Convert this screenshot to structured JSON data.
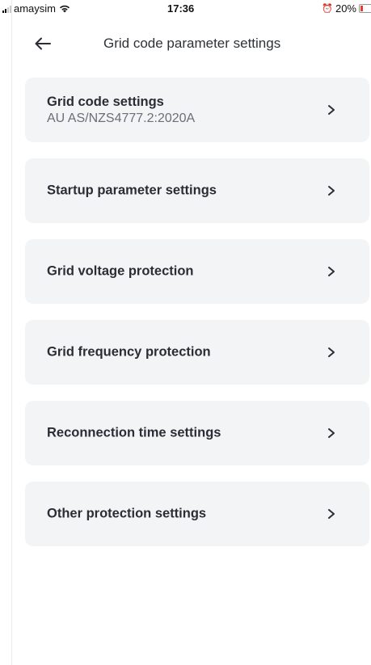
{
  "status_bar": {
    "carrier": "amaysim",
    "time": "17:36",
    "battery": "20%",
    "battery_color": "#e33b2e"
  },
  "header": {
    "title": "Grid code parameter settings",
    "back_icon": "arrow-left-icon"
  },
  "settings": {
    "grid_code": {
      "label": "Grid code settings",
      "value": "AU AS/NZS4777.2:2020A"
    },
    "items": [
      {
        "label": "Startup parameter settings"
      },
      {
        "label": "Grid voltage protection"
      },
      {
        "label": "Grid frequency protection"
      },
      {
        "label": "Reconnection time settings"
      },
      {
        "label": "Other protection settings"
      }
    ],
    "chevron_icon": "chevron-right-icon"
  },
  "colors": {
    "card_background": "#f2f4f6",
    "text_primary": "#2a2d34",
    "text_secondary": "#6b6f76"
  }
}
